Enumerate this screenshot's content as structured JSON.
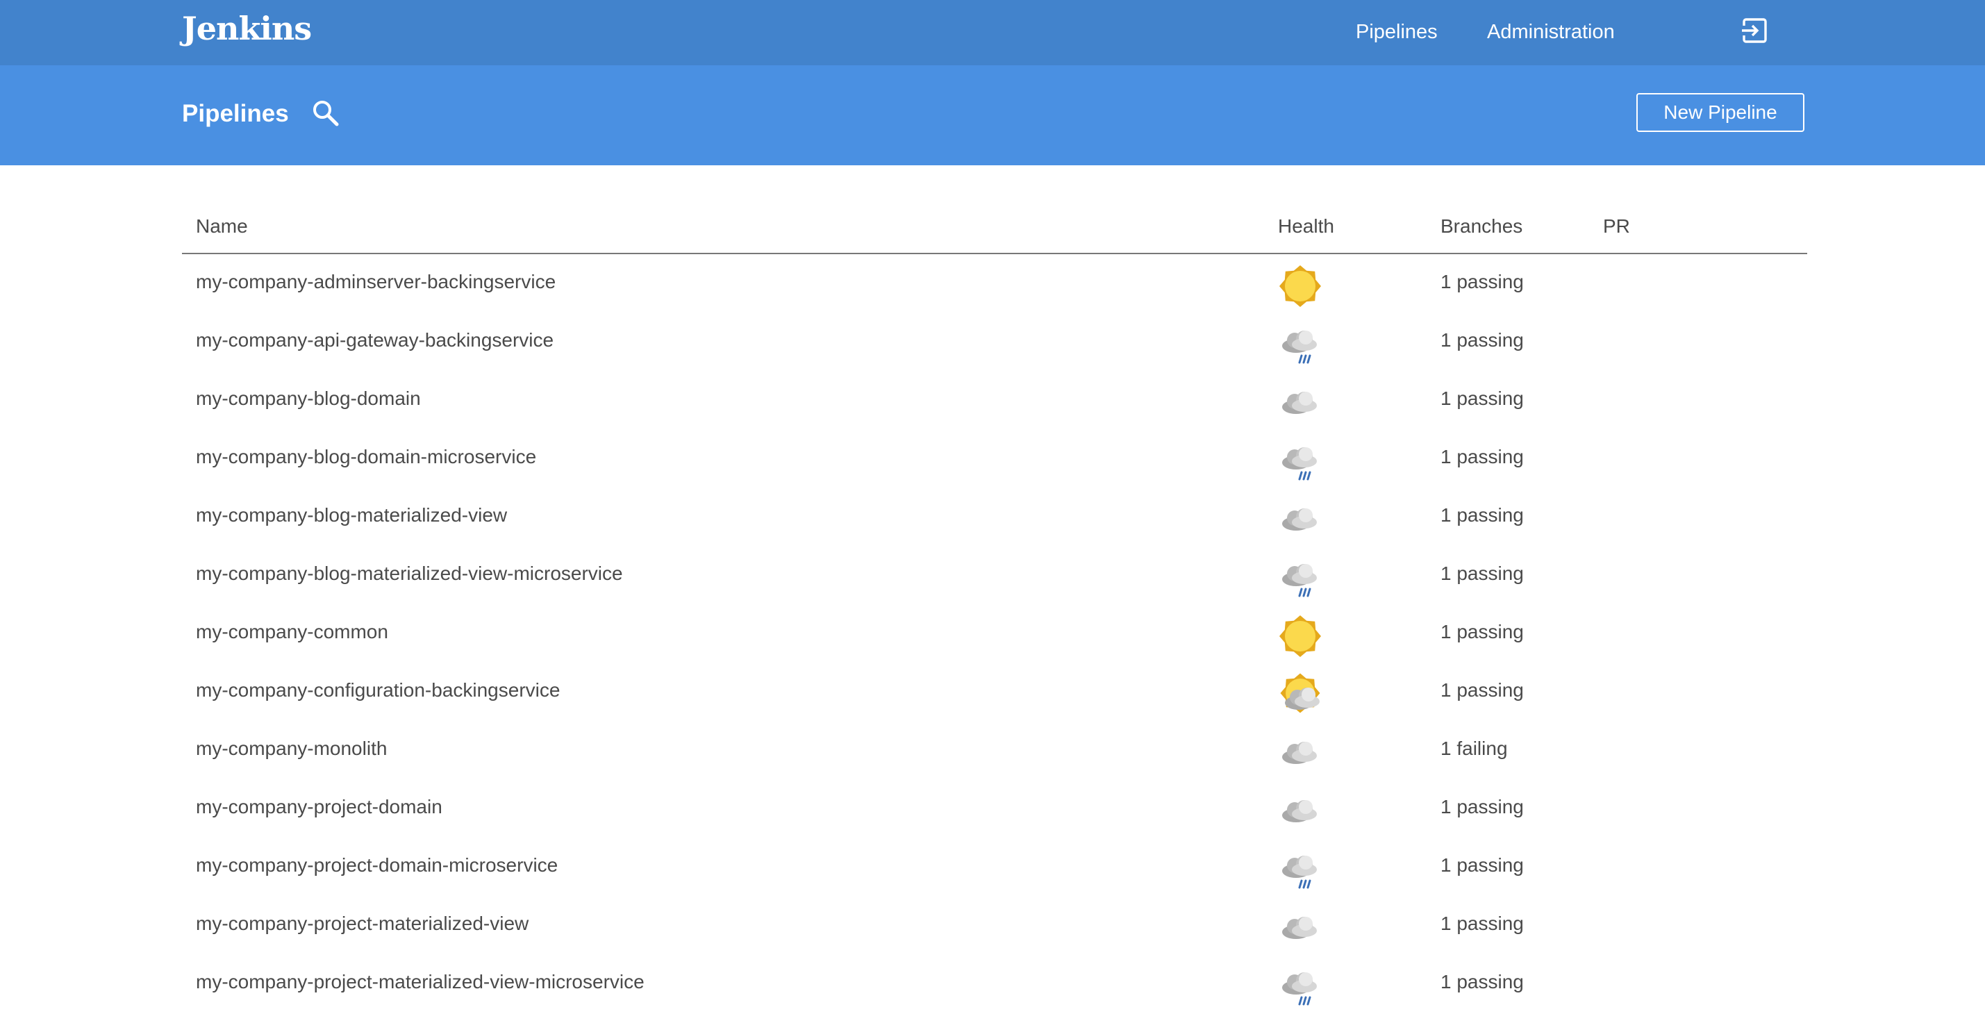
{
  "app": {
    "logo": "Jenkins"
  },
  "topnav": {
    "pipelines": "Pipelines",
    "administration": "Administration",
    "logout_icon": "logout-icon"
  },
  "subheader": {
    "title": "Pipelines",
    "search_icon": "search-icon",
    "new_pipeline": "New Pipeline"
  },
  "table": {
    "headers": {
      "name": "Name",
      "health": "Health",
      "branches": "Branches",
      "pr": "PR"
    },
    "rows": [
      {
        "name": "my-company-adminserver-backingservice",
        "health": "sunny",
        "branches": "1 passing"
      },
      {
        "name": "my-company-api-gateway-backingservice",
        "health": "rain",
        "branches": "1 passing"
      },
      {
        "name": "my-company-blog-domain",
        "health": "cloudy",
        "branches": "1 passing"
      },
      {
        "name": "my-company-blog-domain-microservice",
        "health": "rain",
        "branches": "1 passing"
      },
      {
        "name": "my-company-blog-materialized-view",
        "health": "cloudy",
        "branches": "1 passing"
      },
      {
        "name": "my-company-blog-materialized-view-microservice",
        "health": "rain",
        "branches": "1 passing"
      },
      {
        "name": "my-company-common",
        "health": "sunny",
        "branches": "1 passing"
      },
      {
        "name": "my-company-configuration-backingservice",
        "health": "partly-cloudy",
        "branches": "1 passing"
      },
      {
        "name": "my-company-monolith",
        "health": "cloudy",
        "branches": "1 failing"
      },
      {
        "name": "my-company-project-domain",
        "health": "cloudy",
        "branches": "1 passing"
      },
      {
        "name": "my-company-project-domain-microservice",
        "health": "rain",
        "branches": "1 passing"
      },
      {
        "name": "my-company-project-materialized-view",
        "health": "cloudy",
        "branches": "1 passing"
      },
      {
        "name": "my-company-project-materialized-view-microservice",
        "health": "rain",
        "branches": "1 passing"
      }
    ]
  },
  "colors": {
    "topbar": "#4283cc",
    "subheader": "#4a90e2",
    "sun": "#fbd94c",
    "cloud": "#c8c8c8",
    "rain": "#3b6fb6"
  }
}
